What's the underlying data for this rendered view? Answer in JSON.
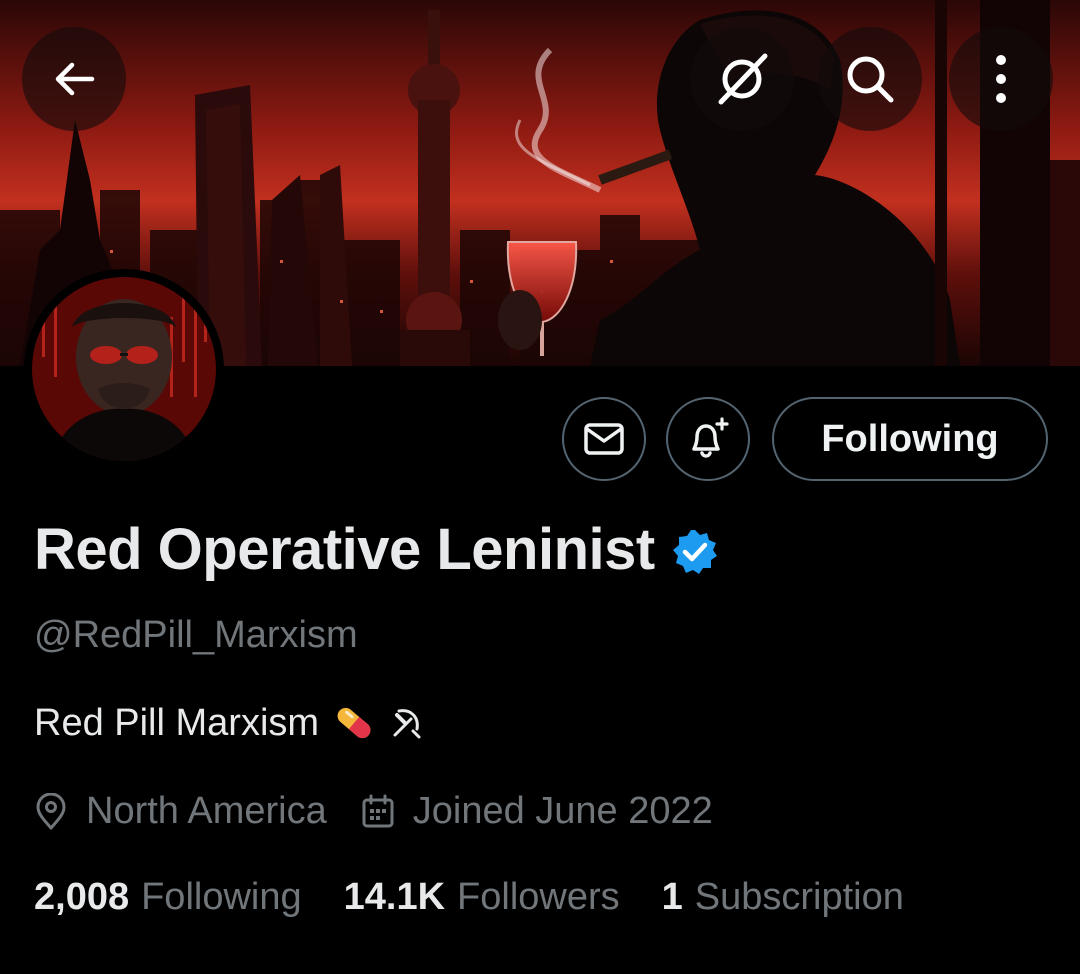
{
  "header": {
    "back_icon": "arrow-left-icon",
    "grok_icon": "grok-icon",
    "search_icon": "search-icon",
    "more_icon": "more-vertical-icon"
  },
  "profile": {
    "display_name": "Red Operative Leninist",
    "verified": true,
    "handle": "@RedPill_Marxism",
    "bio": "Red Pill Marxism",
    "bio_emojis": [
      "pill-emoji",
      "hammer-and-sickle-emoji"
    ],
    "location": "North America",
    "joined": "Joined June 2022"
  },
  "actions": {
    "message_icon": "mail-icon",
    "notify_icon": "bell-plus-icon",
    "follow_label": "Following"
  },
  "stats": {
    "following_count": "2,008",
    "following_label": "Following",
    "followers_count": "14.1K",
    "followers_label": "Followers",
    "subscription_count": "1",
    "subscription_label": "Subscription"
  },
  "colors": {
    "background": "#000000",
    "text_primary": "#e7e9ea",
    "text_secondary": "#71767b",
    "verified_blue": "#1d9bf0",
    "button_border": "#536471",
    "banner_red": "#c0231b"
  }
}
